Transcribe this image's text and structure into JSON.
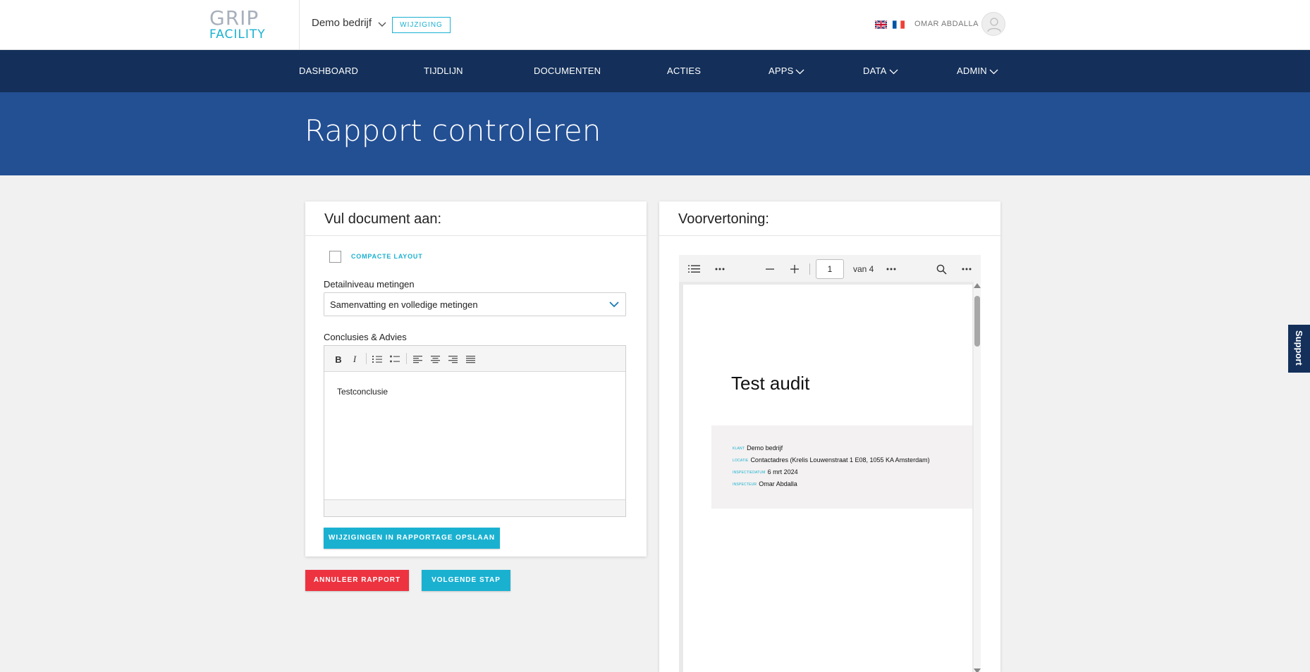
{
  "brand": {
    "logo_top": "GRIP",
    "logo_bottom": "FACILITY"
  },
  "header": {
    "company": "Demo bedrijf",
    "change_label": "WIJZIGING",
    "user_name": "OMAR ABDALLA"
  },
  "nav": {
    "items": [
      {
        "label": "DASHBOARD"
      },
      {
        "label": "TIJDLIJN"
      },
      {
        "label": "DOCUMENTEN"
      },
      {
        "label": "ACTIES"
      },
      {
        "label": "APPS"
      },
      {
        "label": "DATA"
      },
      {
        "label": "ADMIN"
      }
    ]
  },
  "page": {
    "title": "Rapport controleren"
  },
  "support": {
    "label": "Support"
  },
  "form": {
    "title": "Vul document aan:",
    "compact_label": "COMPACTE LAYOUT",
    "detail_label": "Detailniveau metingen",
    "detail_value": "Samenvatting en volledige metingen",
    "conclusions_label": "Conclusies & Advies",
    "editor": {
      "bold": "B",
      "italic": "I",
      "content": "Testconclusie"
    },
    "save_label": "WIJZIGINGEN IN RAPPORTAGE OPSLAAN"
  },
  "actions": {
    "cancel_label": "ANNULEER RAPPORT",
    "next_label": "VOLGENDE STAP"
  },
  "preview": {
    "title": "Voorvertoning:",
    "page_number": "1",
    "page_total": "van 4",
    "doc_title": "Test audit",
    "info": [
      {
        "key": "KLANT",
        "value": "Demo bedrijf"
      },
      {
        "key": "LOCATIE",
        "value": "Contactadres (Krelis Louwenstraat 1 E08, 1055 KA Amsterdam)"
      },
      {
        "key": "INSPECTIEDATUM",
        "value": "6 mrt 2024"
      },
      {
        "key": "INSPECTEUR",
        "value": "Omar Abdalla"
      }
    ]
  },
  "colors": {
    "nav": "#14305a",
    "hero": "#234f93",
    "accent": "#1ab1d1",
    "danger": "#ee3340"
  }
}
